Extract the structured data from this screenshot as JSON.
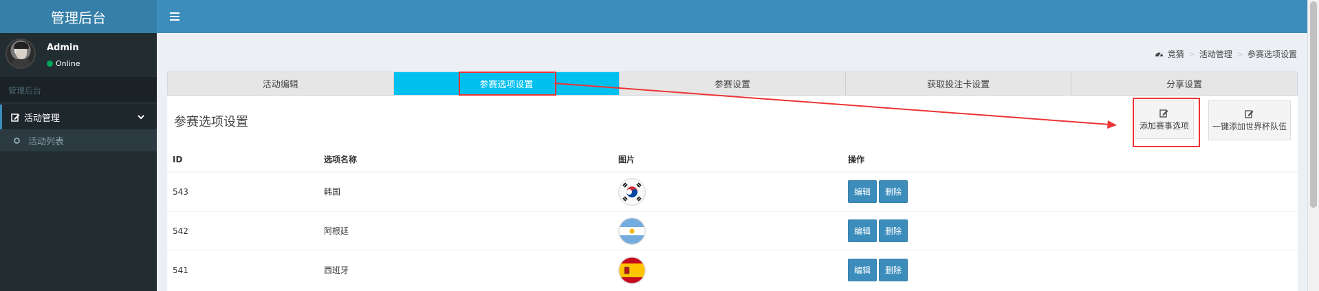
{
  "app": {
    "title": "管理后台"
  },
  "user": {
    "name": "Admin",
    "status": "Online"
  },
  "sidebar": {
    "header": "管理后台",
    "menu": {
      "label": "活动管理"
    },
    "submenu": {
      "label": "活动列表"
    }
  },
  "breadcrumb": [
    "竞猜",
    "活动管理",
    "参赛选项设置"
  ],
  "tabs": [
    {
      "label": "活动编辑"
    },
    {
      "label": "参赛选项设置"
    },
    {
      "label": "参赛设置"
    },
    {
      "label": "获取投注卡设置"
    },
    {
      "label": "分享设置"
    }
  ],
  "active_tab": 1,
  "box": {
    "title": "参赛选项设置",
    "add_button": "添加赛事选项",
    "world_cup_button": "一键添加世界杯队伍"
  },
  "table": {
    "headers": [
      "ID",
      "选项名称",
      "图片",
      "操作"
    ],
    "rows": [
      {
        "id": "543",
        "name": "韩国",
        "flag": "korea-flag-icon"
      },
      {
        "id": "542",
        "name": "阿根廷",
        "flag": "argentina-flag-icon"
      },
      {
        "id": "541",
        "name": "西班牙",
        "flag": "spain-flag-icon"
      }
    ],
    "edit_label": "编辑",
    "delete_label": "删除"
  },
  "colors": {
    "header": "#3c8dbc",
    "logo": "#367fa9",
    "sidebar": "#222d32",
    "active_tab": "#00c0ef",
    "button": "#3c8dbc",
    "annotation": "#ee3333"
  }
}
